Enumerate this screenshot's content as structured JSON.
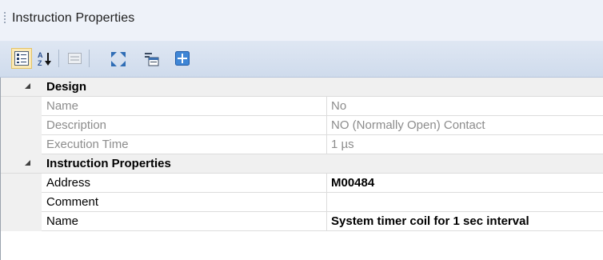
{
  "panel": {
    "title": "Instruction Properties"
  },
  "toolbar": {
    "buttons": [
      {
        "icon": "categorized-icon",
        "active": true
      },
      {
        "icon": "alphabetical-sort-icon"
      },
      {
        "icon": "property-pages-icon",
        "disabled": true
      },
      {
        "icon": "expand-all-icon"
      },
      {
        "icon": "properties-window-icon"
      },
      {
        "icon": "add-icon"
      }
    ]
  },
  "grid": {
    "categories": [
      {
        "label": "Design",
        "rows": [
          {
            "name": "Name",
            "value": "No"
          },
          {
            "name": "Description",
            "value": "NO (Normally Open) Contact"
          },
          {
            "name": "Execution Time",
            "value": "1 µs"
          }
        ]
      },
      {
        "label": "Instruction Properties",
        "rows": [
          {
            "name": "Address",
            "value": "M00484"
          },
          {
            "name": "Comment",
            "value": ""
          },
          {
            "name": "Name",
            "value": "System timer coil for 1 sec interval"
          }
        ]
      }
    ]
  },
  "colors": {
    "title_bar": "#eef2f9",
    "toolbar": "#d6e0ee",
    "category_row": "#f0f0f0",
    "readonly_text": "#8c8c8c",
    "active_button": "#fbe9b6"
  }
}
